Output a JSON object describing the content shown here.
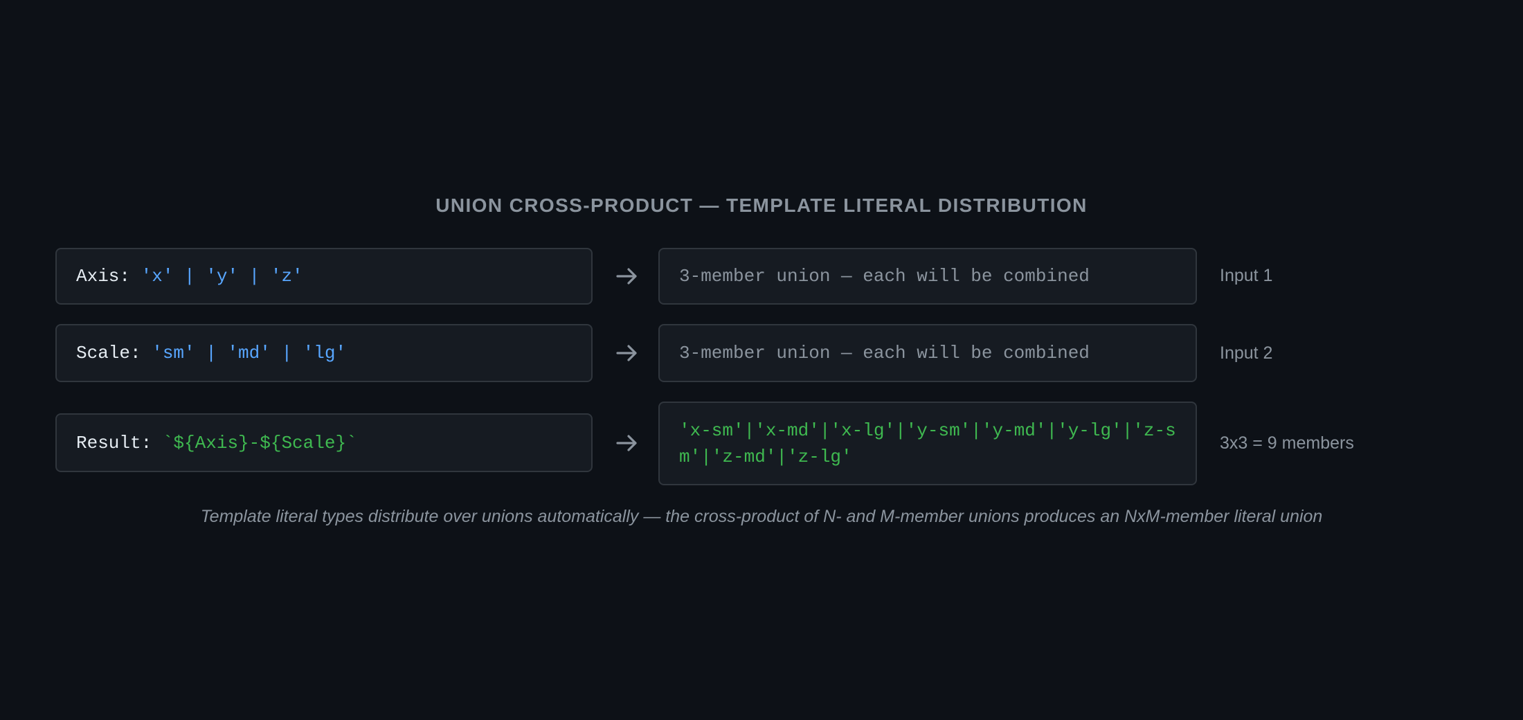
{
  "title": "UNION CROSS-PRODUCT — TEMPLATE LITERAL DISTRIBUTION",
  "rows": [
    {
      "left_key": "Axis: ",
      "left_value": "'x' | 'y' | 'z'",
      "right_text": "3-member union — each will be combined",
      "side_label": "Input 1"
    },
    {
      "left_key": "Scale: ",
      "left_value": "'sm' | 'md' | 'lg'",
      "right_text": "3-member union — each will be combined",
      "side_label": "Input 2"
    },
    {
      "left_key": "Result: ",
      "left_value": "`${Axis}-${Scale}`",
      "right_text": "'x-sm'|'x-md'|'x-lg'|'y-sm'|'y-md'|'y-lg'|'z-sm'|'z-md'|'z-lg'",
      "side_label": "3x3 = 9 members"
    }
  ],
  "caption": "Template literal types distribute over unions automatically — the cross-product of N- and M-member unions produces an NxM-member literal union",
  "icons": {
    "arrow": "arrow-right-icon"
  },
  "colors": {
    "background": "#0d1117",
    "box": "#161b22",
    "border": "#30363d",
    "blue": "#58a6ff",
    "green": "#3fb950",
    "muted": "#8b949e"
  }
}
